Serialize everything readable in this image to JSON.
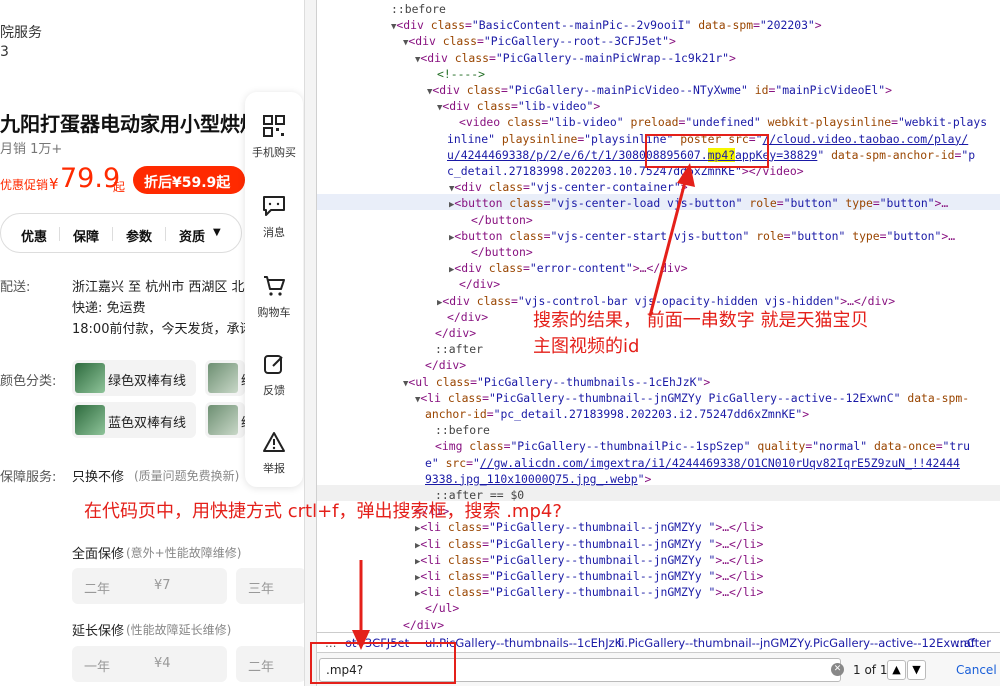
{
  "product": {
    "service_label_partial": "院服务",
    "service_number_partial": "3",
    "title": "九阳打蛋器电动家用小型烘焙",
    "sales": "月销 1万+",
    "promo_label": "优惠促销",
    "price_symbol": "¥",
    "price": "79.9",
    "price_suffix": "起",
    "after_discount": "折后¥59.9起",
    "tabs": [
      "优惠",
      "保障",
      "参数",
      "资质"
    ],
    "delivery_label": "配送:",
    "delivery_route": "浙江嘉兴 至 杭州市 西湖区 北",
    "delivery_courier": "快递: 免运费",
    "delivery_time": "18:00前付款，今天发货，承诺",
    "color_label": "颜色分类:",
    "skus": [
      "绿色双棒有线",
      "绿",
      "蓝色双棒有线",
      "绿"
    ],
    "guarantee_label": "保障服务:",
    "guarantee_main": "只换不修",
    "guarantee_main_note": "(质量问题免费换新)",
    "full_warranty": "全面保修",
    "full_warranty_note": "(意外+性能故障维修)",
    "full_options": [
      {
        "period": "二年",
        "price": "¥7"
      },
      {
        "period": "三年",
        "price": ""
      }
    ],
    "ext_warranty": "延长保修",
    "ext_warranty_note": "(性能故障延长维修)",
    "ext_options": [
      {
        "period": "一年",
        "price": "¥4"
      },
      {
        "period": "二年",
        "price": ""
      }
    ]
  },
  "sidebar": [
    {
      "label": "手机购买",
      "icon": "qr-code-icon"
    },
    {
      "label": "消息",
      "icon": "chat-icon"
    },
    {
      "label": "购物车",
      "icon": "cart-icon"
    },
    {
      "label": "反馈",
      "icon": "edit-icon"
    },
    {
      "label": "举报",
      "icon": "warning-icon"
    }
  ],
  "devtools": {
    "breadcrumbs": [
      "…",
      "ot--3CFJ5et",
      "ul.PicGallery--thumbnails--1cEhJzK",
      "li.PicGallery--thumbnail--jnGMZYy.PicGallery--active--12ExwnC",
      "::after"
    ],
    "search_value": ".mp4?",
    "match_count": "1 of 1",
    "cancel": "Cancel"
  },
  "annotations": {
    "result_note_line1": "搜索的结果，  前面一串数字 就是天猫宝贝",
    "result_note_line2": "主图视频的id",
    "instruction": "在代码页中，用快捷方式 crtl+f，弹出搜索框，搜索 .mp4?"
  },
  "colors": {
    "accent_red": "#e4201a",
    "price_red": "#ff2a00",
    "tag_color": "#881280",
    "attr_color": "#994500",
    "value_color": "#1a1aa6"
  }
}
